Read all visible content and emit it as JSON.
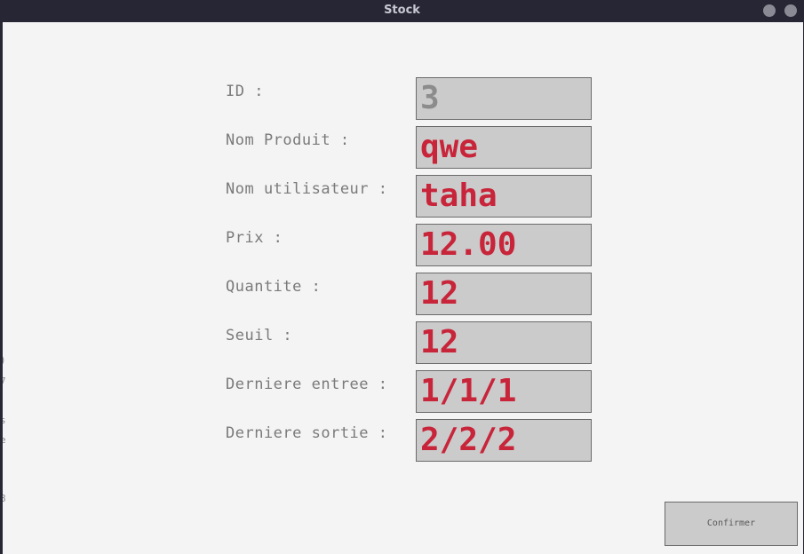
{
  "window": {
    "title": "Stock"
  },
  "edge_text": [
    ")",
    "7",
    "s",
    "e",
    "8"
  ],
  "form": {
    "fields": [
      {
        "label": "ID :",
        "value": "3"
      },
      {
        "label": "Nom Produit :",
        "value": "qwe"
      },
      {
        "label": "Nom utilisateur :",
        "value": "taha"
      },
      {
        "label": "Prix :",
        "value": "12.00"
      },
      {
        "label": "Quantite :",
        "value": "12"
      },
      {
        "label": "Seuil :",
        "value": "12"
      },
      {
        "label": "Derniere entree :",
        "value": "1/1/1"
      },
      {
        "label": "Derniere sortie :",
        "value": "2/2/2"
      }
    ],
    "confirm_label": "Confirmer"
  },
  "colors": {
    "titlebar": "#262634",
    "background": "#f4f4f4",
    "field_background": "#cbcbcb",
    "value_text": "#c8243a",
    "readonly_text": "#8c8c8c",
    "label_text": "#7a7a7a"
  }
}
